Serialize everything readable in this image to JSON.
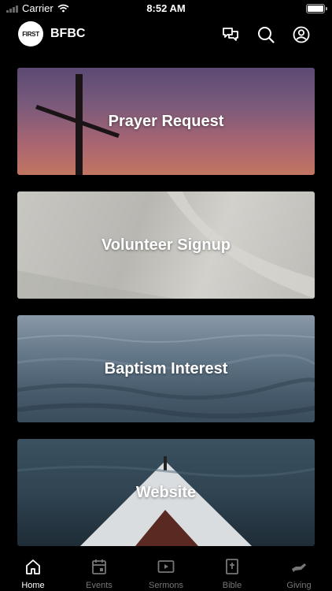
{
  "status_bar": {
    "carrier": "Carrier",
    "time": "8:52 AM"
  },
  "header": {
    "logo_text": "FIRST",
    "title": "BFBC"
  },
  "cards": [
    {
      "label": "Prayer Request"
    },
    {
      "label": "Volunteer Signup"
    },
    {
      "label": "Baptism Interest"
    },
    {
      "label": "Website"
    }
  ],
  "tabs": [
    {
      "label": "Home",
      "icon": "home-icon",
      "active": true
    },
    {
      "label": "Events",
      "icon": "calendar-icon",
      "active": false
    },
    {
      "label": "Sermons",
      "icon": "play-icon",
      "active": false
    },
    {
      "label": "Bible",
      "icon": "bible-icon",
      "active": false
    },
    {
      "label": "Giving",
      "icon": "giving-hand-icon",
      "active": false
    }
  ],
  "colors": {
    "background": "#000000",
    "active_tab": "#ffffff",
    "inactive_tab": "#777777"
  }
}
